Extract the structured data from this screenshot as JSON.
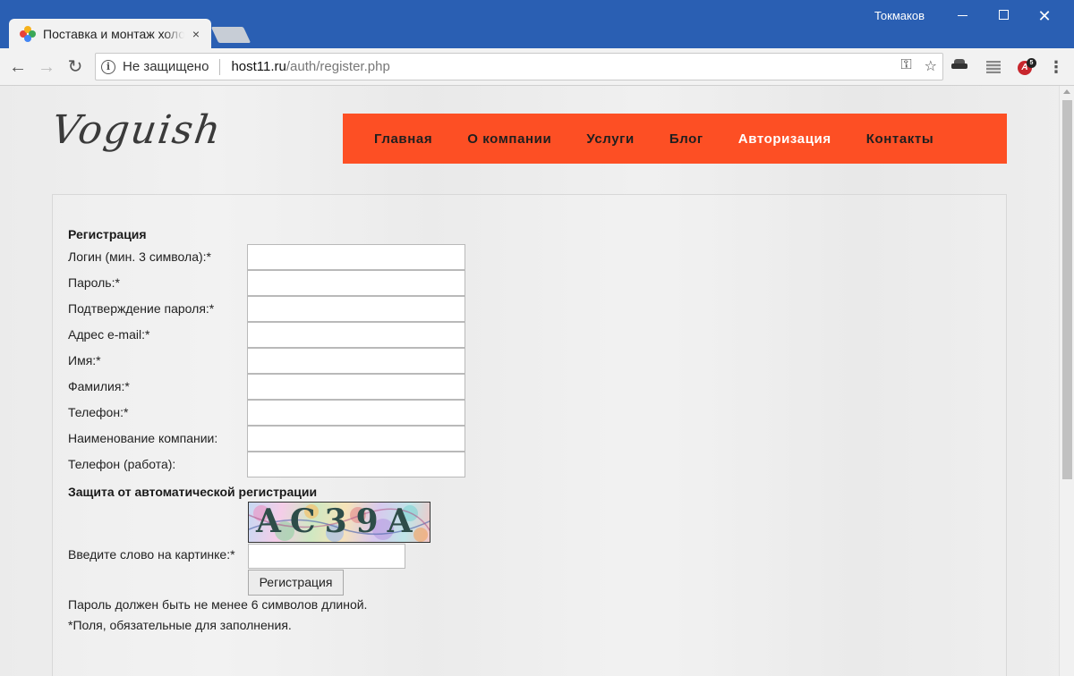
{
  "window": {
    "user": "Токмаков",
    "tab_title": "Поставка и монтаж холодильного оборудования",
    "tab_close": "×"
  },
  "toolbar": {
    "security_label": "Не защищено",
    "url_host": "host11.ru",
    "url_path": "/auth/register.php"
  },
  "site": {
    "logo": "Voguish",
    "nav": [
      {
        "label": "Главная",
        "active": false
      },
      {
        "label": "О компании",
        "active": false
      },
      {
        "label": "Услуги",
        "active": false
      },
      {
        "label": "Блог",
        "active": false
      },
      {
        "label": "Авторизация",
        "active": true
      },
      {
        "label": "Контакты",
        "active": false
      }
    ],
    "nav_color": "#fd4f24"
  },
  "form": {
    "title": "Регистрация",
    "fields": [
      {
        "label": "Логин (мин. 3 символа):*",
        "value": ""
      },
      {
        "label": "Пароль:*",
        "value": ""
      },
      {
        "label": "Подтверждение пароля:*",
        "value": ""
      },
      {
        "label": "Адрес e-mail:*",
        "value": ""
      },
      {
        "label": "Имя:*",
        "value": ""
      },
      {
        "label": "Фамилия:*",
        "value": ""
      },
      {
        "label": "Телефон:*",
        "value": ""
      },
      {
        "label": "Наименование компании:",
        "value": ""
      },
      {
        "label": "Телефон (работа):",
        "value": ""
      }
    ],
    "captcha_title": "Защита от автоматической регистрации",
    "captcha_text": "AC39A",
    "captcha_label": "Введите слово на картинке:*",
    "submit_label": "Регистрация",
    "note_password": "Пароль должен быть не менее 6 символов длиной.",
    "note_required": "*Поля, обязательные для заполнения."
  }
}
